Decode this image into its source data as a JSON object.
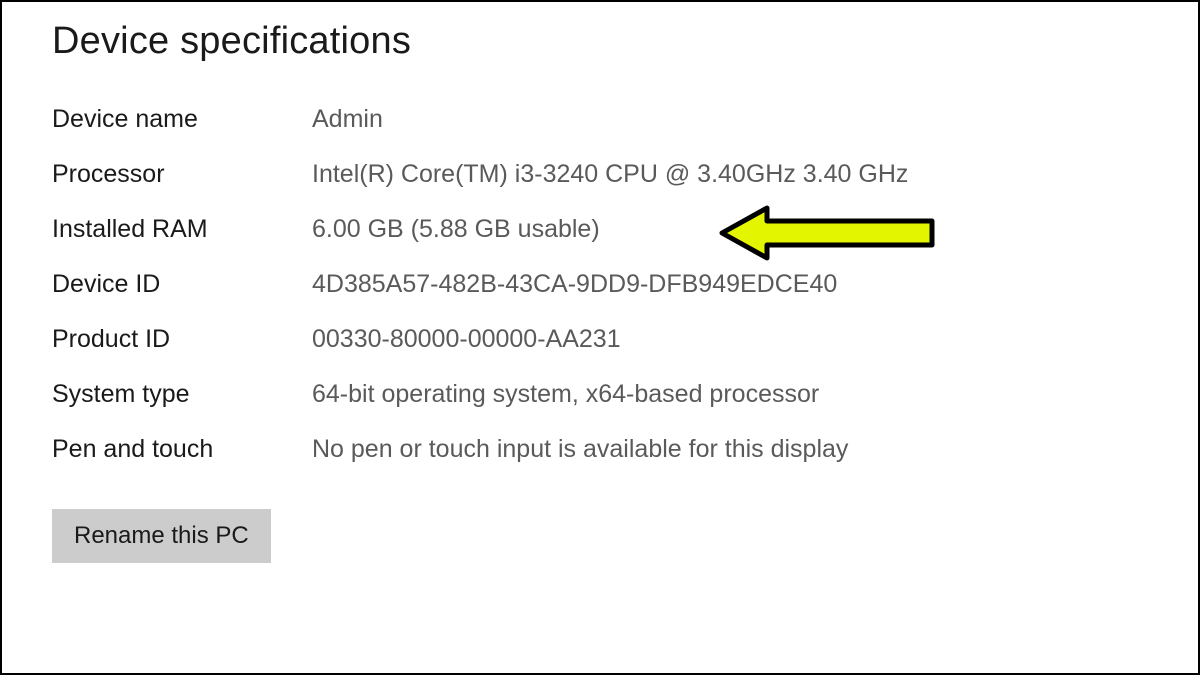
{
  "heading": "Device specifications",
  "specs": [
    {
      "label": "Device name",
      "value": "Admin"
    },
    {
      "label": "Processor",
      "value": "Intel(R) Core(TM) i3-3240 CPU @ 3.40GHz   3.40 GHz"
    },
    {
      "label": "Installed RAM",
      "value": "6.00 GB (5.88 GB usable)"
    },
    {
      "label": "Device ID",
      "value": "4D385A57-482B-43CA-9DD9-DFB949EDCE40"
    },
    {
      "label": "Product ID",
      "value": "00330-80000-00000-AA231"
    },
    {
      "label": "System type",
      "value": "64-bit operating system, x64-based processor"
    },
    {
      "label": "Pen and touch",
      "value": "No pen or touch input is available for this display"
    }
  ],
  "rename_button_label": "Rename this PC",
  "annotation": {
    "target_row_index": 2,
    "arrow_color": "#e4f500",
    "arrow_stroke": "#000000"
  }
}
